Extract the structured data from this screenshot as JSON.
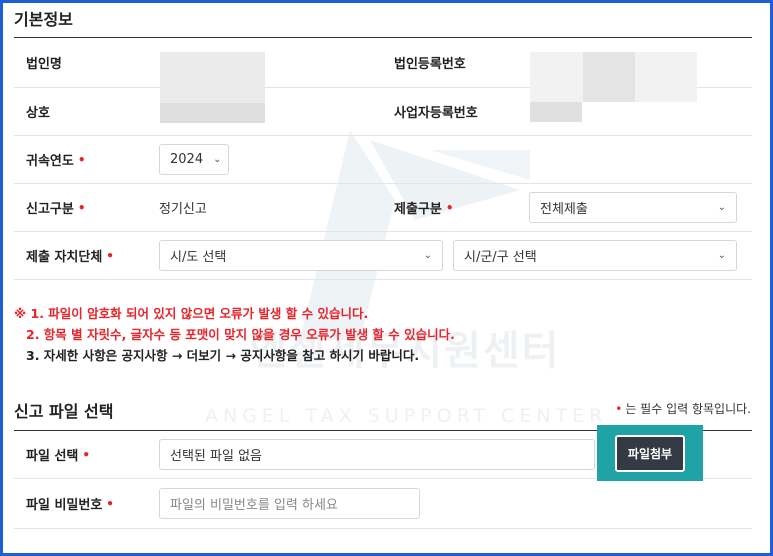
{
  "basic": {
    "title": "기본정보",
    "corp_name_label": "법인명",
    "corp_reg_label": "법인등록번호",
    "trade_name_label": "상호",
    "biz_reg_label": "사업자등록번호",
    "year_label": "귀속연도",
    "year_value": "2024",
    "report_type_label": "신고구분",
    "report_type_value": "정기신고",
    "submit_type_label": "제출구분",
    "submit_type_value": "전체제출",
    "local_gov_label": "제출 자치단체",
    "sido_select": "시/도 선택",
    "sigungu_select": "시/군/구 선택",
    "required_mark": "•"
  },
  "notes": [
    "※ 1. 파일이 암호화 되어 있지 않으면 오류가 발생 할 수 있습니다.",
    "2. 항목 별 자릿수, 글자수 등 포맷이 맞지 않을 경우 오류가 발생 할 수 있습니다.",
    "3. 자세한 사항은 공지사항 → 더보기 → 공지사항을 참고 하시기 바랍니다."
  ],
  "file": {
    "title": "신고 파일 선택",
    "required_note": "는 필수 입력 항목입니다.",
    "file_label": "파일 선택",
    "file_value": "선택된 파일 없음",
    "attach_button": "파일첨부",
    "password_label": "파일 비밀번호",
    "password_placeholder": "파일의 비밀번호를 입력 하세요"
  },
  "watermark": {
    "title": "엔젤세무지원센터",
    "subtitle": "ANGEL TAX SUPPORT CENTER"
  },
  "colors": {
    "frame": "#1f5fd6",
    "required": "#e8242b",
    "highlight": "#1fa3a7",
    "button": "#333a44"
  }
}
